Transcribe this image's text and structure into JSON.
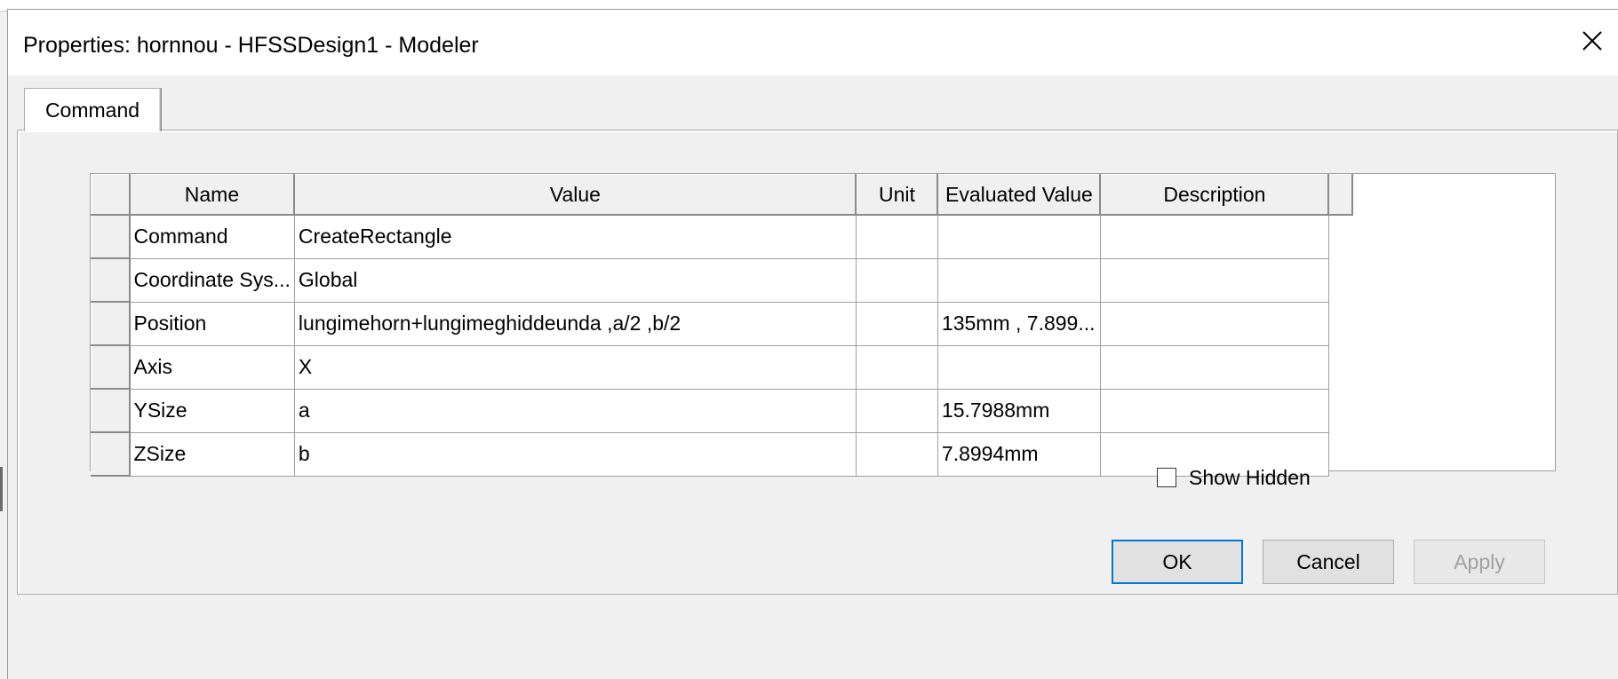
{
  "window": {
    "title": "Properties: hornnou - HFSSDesign1 - Modeler",
    "close_icon": "close-icon"
  },
  "tabs": [
    {
      "label": "Command",
      "active": true
    }
  ],
  "grid": {
    "columns": [
      "Name",
      "Value",
      "Unit",
      "Evaluated Value",
      "Description"
    ],
    "rows": [
      {
        "name": "Command",
        "value": "CreateRectangle",
        "unit": "",
        "evaluated": "",
        "description": ""
      },
      {
        "name": "Coordinate Sys...",
        "value": "Global",
        "unit": "",
        "evaluated": "",
        "description": ""
      },
      {
        "name": "Position",
        "value": "lungimehorn+lungimeghiddeunda ,a/2 ,b/2",
        "unit": "",
        "evaluated": "135mm , 7.899...",
        "description": ""
      },
      {
        "name": "Axis",
        "value": "X",
        "unit": "",
        "evaluated": "",
        "description": ""
      },
      {
        "name": "YSize",
        "value": "a",
        "unit": "",
        "evaluated": "15.7988mm",
        "description": ""
      },
      {
        "name": "ZSize",
        "value": "b",
        "unit": "",
        "evaluated": "7.8994mm",
        "description": ""
      }
    ]
  },
  "show_hidden": {
    "label": "Show Hidden",
    "checked": false
  },
  "buttons": {
    "ok": "OK",
    "cancel": "Cancel",
    "apply": "Apply"
  },
  "colors": {
    "accent": "#0078d7",
    "disabled_text": "#a0a0a0"
  }
}
